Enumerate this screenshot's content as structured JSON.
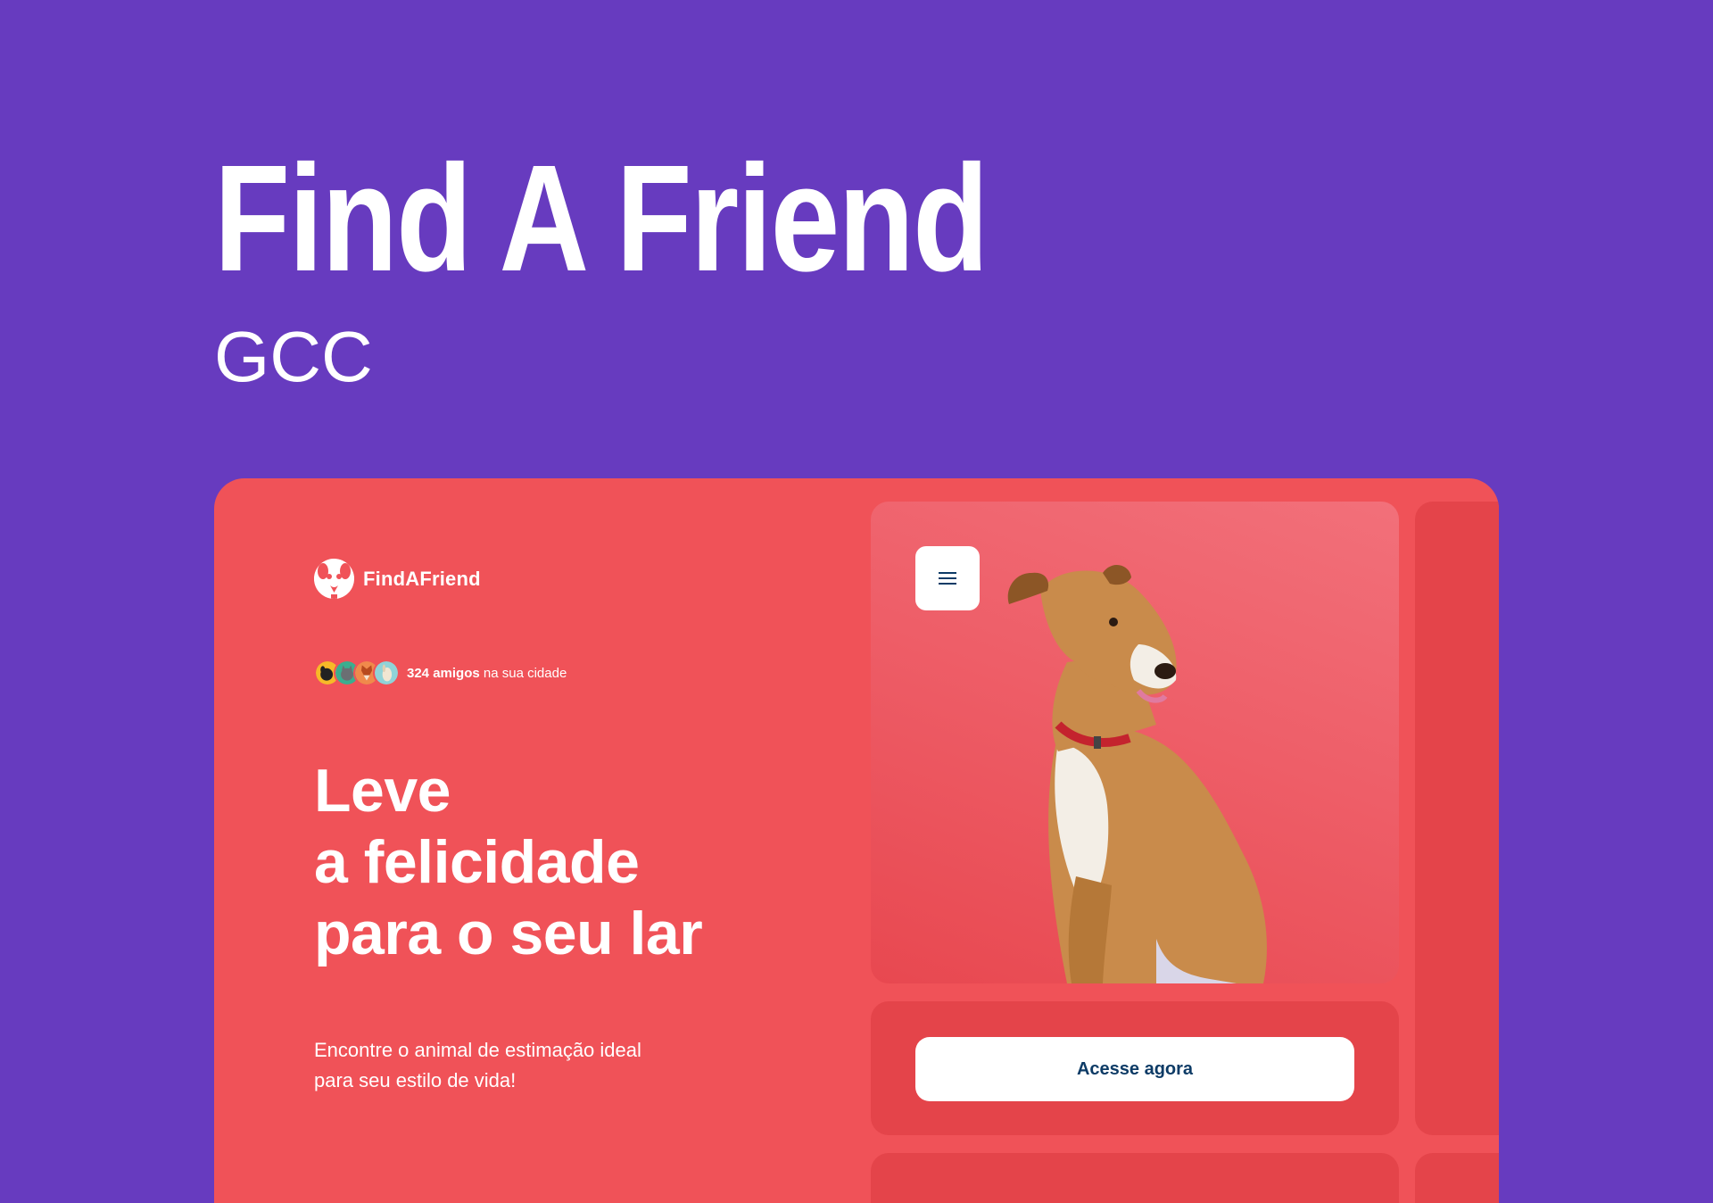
{
  "page": {
    "title": "Find A Friend",
    "subtitle": "GCC"
  },
  "app": {
    "brand_name": "FindAFriend",
    "friends_count": "324 amigos",
    "friends_suffix": " na sua cidade",
    "headline_lines": [
      "Leve",
      "a felicidade",
      "para o seu lar"
    ],
    "tagline_lines": [
      "Encontre o animal de estimação ideal",
      "para seu estilo de vida!"
    ],
    "cta_label": "Acesse agora",
    "icons": {
      "logo": "dog-face-logo-icon",
      "menu": "hamburger-menu-icon"
    },
    "avatars": [
      "black-dog-avatar",
      "gray-cat-avatar",
      "fox-avatar",
      "white-dog-avatar"
    ]
  },
  "colors": {
    "background": "#673BBF",
    "card": "#F05258",
    "card_dark": "#E4444A",
    "cta_text": "#0D3B66",
    "white": "#FFFFFF"
  }
}
